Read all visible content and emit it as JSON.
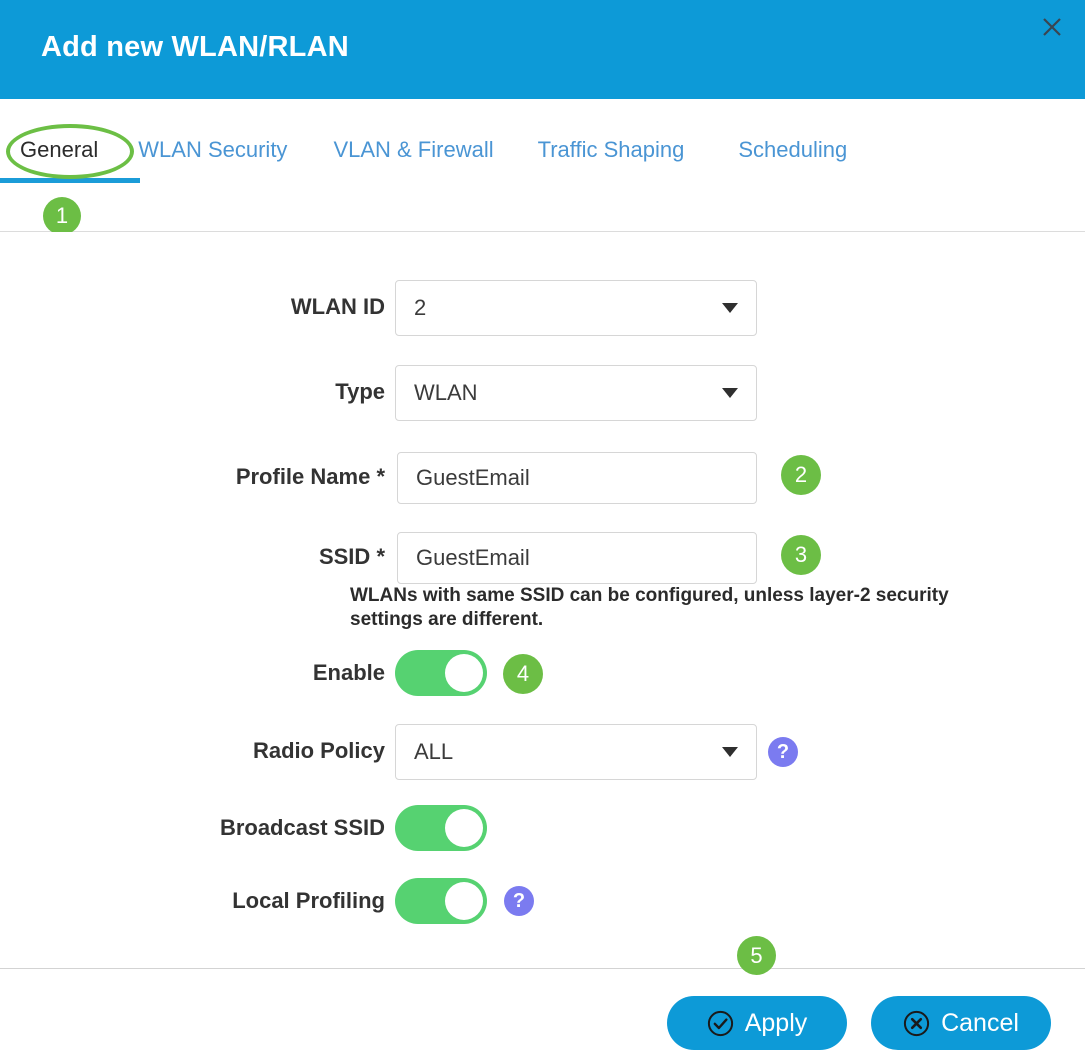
{
  "dialog": {
    "title": "Add new WLAN/RLAN",
    "close_icon": "close-x-icon",
    "header_color": "#0d9ad7"
  },
  "tabs": {
    "items": [
      {
        "label": "General",
        "active": true
      },
      {
        "label": "WLAN Security",
        "active": false
      },
      {
        "label": "VLAN & Firewall",
        "active": false
      },
      {
        "label": "Traffic Shaping",
        "active": false
      },
      {
        "label": "Scheduling",
        "active": false
      }
    ],
    "active_color": "#2b2b2b",
    "inactive_color": "#4a95d4",
    "underline_color": "#1b9cd8"
  },
  "form": {
    "wlan_id": {
      "label": "WLAN ID",
      "value": "2",
      "control": "dropdown"
    },
    "type": {
      "label": "Type",
      "value": "WLAN",
      "control": "dropdown"
    },
    "profile_name": {
      "label": "Profile Name",
      "required_mark": "*",
      "value": "GuestEmail",
      "control": "text"
    },
    "ssid": {
      "label": "SSID",
      "required_mark": "*",
      "value": "GuestEmail",
      "control": "text",
      "helper_text": "WLANs with same SSID can be configured, unless layer-2 security settings are different."
    },
    "enable": {
      "label": "Enable",
      "value": "on",
      "control": "toggle"
    },
    "radio_policy": {
      "label": "Radio Policy",
      "value": "ALL",
      "control": "dropdown",
      "help_icon": "question-mark-icon"
    },
    "broadcast_ssid": {
      "label": "Broadcast SSID",
      "value": "on",
      "control": "toggle"
    },
    "local_profiling": {
      "label": "Local Profiling",
      "value": "on",
      "control": "toggle",
      "help_icon": "question-mark-icon"
    },
    "toggle_on_color": "#56d271",
    "help_icon_color": "#7b7bf0"
  },
  "footer": {
    "apply_label": "Apply",
    "apply_icon": "check-circle-icon",
    "cancel_label": "Cancel",
    "cancel_icon": "x-circle-icon",
    "button_color": "#0d9ad7"
  },
  "annotations": {
    "color": "#6cbe45",
    "badges": [
      {
        "number": "1"
      },
      {
        "number": "2"
      },
      {
        "number": "3"
      },
      {
        "number": "4"
      },
      {
        "number": "5"
      }
    ],
    "ellipse_target": "General"
  }
}
